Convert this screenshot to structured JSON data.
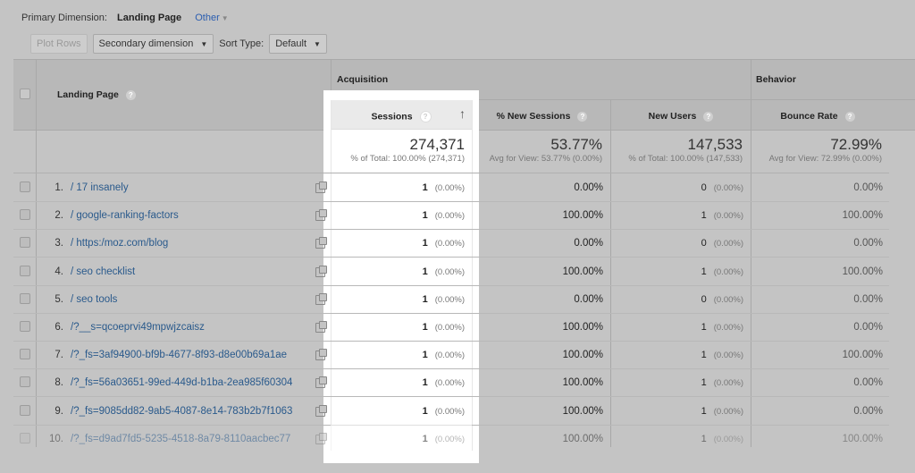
{
  "primary_dimension": {
    "label": "Primary Dimension:",
    "value": "Landing Page",
    "other": "Other"
  },
  "toolbar": {
    "plot_rows": "Plot Rows",
    "secondary_dimension": "Secondary dimension",
    "sort_type_label": "Sort Type:",
    "sort_type_value": "Default"
  },
  "groups": {
    "acquisition": "Acquisition",
    "behavior": "Behavior"
  },
  "columns": {
    "landing_page": "Landing Page",
    "sessions": "Sessions",
    "new_sessions": "% New Sessions",
    "new_users": "New Users",
    "bounce_rate": "Bounce Rate"
  },
  "totals": {
    "sessions": {
      "value": "274,371",
      "sub": "% of Total: 100.00% (274,371)"
    },
    "new_sessions": {
      "value": "53.77%",
      "sub": "Avg for View: 53.77% (0.00%)"
    },
    "new_users": {
      "value": "147,533",
      "sub": "% of Total: 100.00% (147,533)"
    },
    "bounce_rate": {
      "value": "72.99%",
      "sub": "Avg for View: 72.99% (0.00%)"
    }
  },
  "rows": [
    {
      "idx": "1.",
      "page": "/ 17 insanely",
      "sessions": "1",
      "sessions_pct": "(0.00%)",
      "new_sessions": "0.00%",
      "new_users": "0",
      "new_users_pct": "(0.00%)",
      "bounce_rate": "0.00%"
    },
    {
      "idx": "2.",
      "page": "/ google-ranking-factors",
      "sessions": "1",
      "sessions_pct": "(0.00%)",
      "new_sessions": "100.00%",
      "new_users": "1",
      "new_users_pct": "(0.00%)",
      "bounce_rate": "100.00%"
    },
    {
      "idx": "3.",
      "page": "/ https:/moz.com/blog",
      "sessions": "1",
      "sessions_pct": "(0.00%)",
      "new_sessions": "0.00%",
      "new_users": "0",
      "new_users_pct": "(0.00%)",
      "bounce_rate": "0.00%"
    },
    {
      "idx": "4.",
      "page": "/ seo checklist",
      "sessions": "1",
      "sessions_pct": "(0.00%)",
      "new_sessions": "100.00%",
      "new_users": "1",
      "new_users_pct": "(0.00%)",
      "bounce_rate": "100.00%"
    },
    {
      "idx": "5.",
      "page": "/ seo tools",
      "sessions": "1",
      "sessions_pct": "(0.00%)",
      "new_sessions": "0.00%",
      "new_users": "0",
      "new_users_pct": "(0.00%)",
      "bounce_rate": "0.00%"
    },
    {
      "idx": "6.",
      "page": "/?__s=qcoeprvi49mpwjzcaisz",
      "sessions": "1",
      "sessions_pct": "(0.00%)",
      "new_sessions": "100.00%",
      "new_users": "1",
      "new_users_pct": "(0.00%)",
      "bounce_rate": "0.00%"
    },
    {
      "idx": "7.",
      "page": "/?_fs=3af94900-bf9b-4677-8f93-d8e00b69a1ae",
      "sessions": "1",
      "sessions_pct": "(0.00%)",
      "new_sessions": "100.00%",
      "new_users": "1",
      "new_users_pct": "(0.00%)",
      "bounce_rate": "100.00%"
    },
    {
      "idx": "8.",
      "page": "/?_fs=56a03651-99ed-449d-b1ba-2ea985f60304",
      "sessions": "1",
      "sessions_pct": "(0.00%)",
      "new_sessions": "100.00%",
      "new_users": "1",
      "new_users_pct": "(0.00%)",
      "bounce_rate": "0.00%"
    },
    {
      "idx": "9.",
      "page": "/?_fs=9085dd82-9ab5-4087-8e14-783b2b7f1063",
      "sessions": "1",
      "sessions_pct": "(0.00%)",
      "new_sessions": "100.00%",
      "new_users": "1",
      "new_users_pct": "(0.00%)",
      "bounce_rate": "0.00%"
    },
    {
      "idx": "10.",
      "page": "/?_fs=d9ad7fd5-5235-4518-8a79-8110aacbec77",
      "sessions": "1",
      "sessions_pct": "(0.00%)",
      "new_sessions": "100.00%",
      "new_users": "1",
      "new_users_pct": "(0.00%)",
      "bounce_rate": "100.00%"
    }
  ]
}
